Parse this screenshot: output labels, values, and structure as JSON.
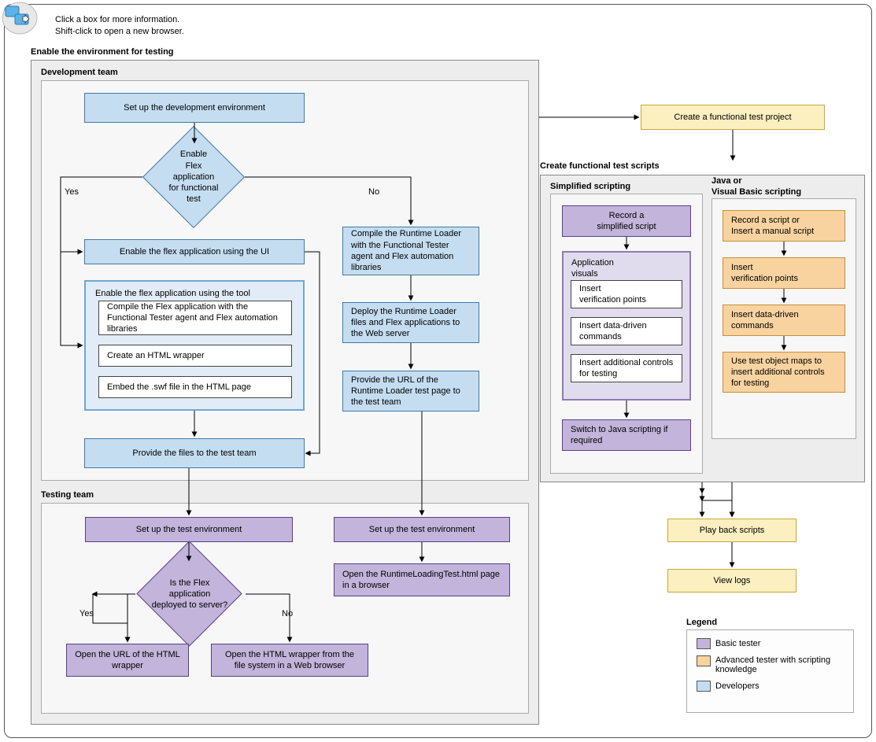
{
  "help": {
    "line1": "Click a box for more information.",
    "line2": "Shift-click to open a new browser."
  },
  "sections": {
    "enable_env": "Enable the environment for testing",
    "dev_team": "Development team",
    "test_team": "Testing team",
    "create_scripts": "Create functional test scripts",
    "simplified": "Simplified scripting",
    "java_vb": "Java or\nVisual Basic scripting"
  },
  "labels": {
    "yes": "Yes",
    "no": "No"
  },
  "dev": {
    "setup_env": "Set up the development environment",
    "decision1": "Enable\nFlex application\nfor functional\ntest",
    "enable_ui": "Enable the flex application using the UI",
    "enable_tool_title": "Enable the flex application using the tool",
    "compile_flex": "Compile the Flex application with the Functional Tester agent and Flex automation libraries",
    "create_wrapper": "Create an HTML wrapper",
    "embed_swf": "Embed the .swf file in the HTML page",
    "provide_files": "Provide the files to the test team",
    "compile_rt": "Compile the Runtime Loader with the Functional Tester agent and Flex automation libraries",
    "deploy_rt": "Deploy the Runtime Loader files and Flex applications to the Web server",
    "provide_url": "Provide the URL of the Runtime Loader test page to the test team"
  },
  "test": {
    "setup1": "Set up the test environment",
    "setup2": "Set up the test environment",
    "decision2": "Is the Flex application deployed to server?",
    "open_url": "Open the URL of the HTML wrapper",
    "open_file": "Open the HTML wrapper from the file system in a Web browser",
    "open_runtime": "Open the RuntimeLoadingTest.html page in a browser"
  },
  "right": {
    "create_proj": "Create a functional test project",
    "playback": "Play back scripts",
    "view_logs": "View logs"
  },
  "simplified": {
    "record": "Record a\nsimplified script",
    "app_visuals": "Application\nvisuals",
    "insert_vp": "Insert\nverification points",
    "insert_dd": "Insert data-driven commands",
    "insert_ctrl": "Insert additional controls for testing",
    "switch_java": "Switch to Java scripting if required"
  },
  "java_vb": {
    "record": "Record a script or\nInsert a manual script",
    "insert_vp": "Insert\nverification points",
    "insert_dd": "Insert data-driven commands",
    "use_maps": "Use test object maps to insert additional controls for testing"
  },
  "legend": {
    "title": "Legend",
    "basic": "Basic tester",
    "advanced": "Advanced tester with scripting knowledge",
    "developers": "Developers"
  },
  "colors": {
    "dev": "#c5ddf1",
    "tester": "#c2b4da",
    "adv": "#f8d3a0",
    "yellow": "#fcefc0"
  }
}
